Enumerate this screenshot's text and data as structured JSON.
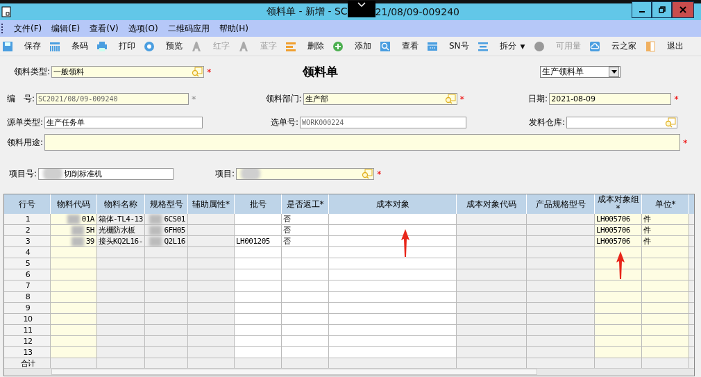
{
  "window": {
    "title_left": "领料单 - 新增 - SC",
    "title_right": "21/08/09-009240"
  },
  "menu": [
    "文件(F)",
    "编辑(E)",
    "查看(V)",
    "选项(O)",
    "二维码应用",
    "帮助(H)"
  ],
  "toolbar": [
    {
      "label": "保存",
      "disabled": false
    },
    {
      "label": "条码",
      "disabled": false
    },
    {
      "label": "打印",
      "disabled": false
    },
    {
      "label": "预览",
      "disabled": false
    },
    {
      "label": "红字",
      "disabled": true
    },
    {
      "label": "蓝字",
      "disabled": true
    },
    {
      "label": "删除",
      "disabled": false
    },
    {
      "label": "添加",
      "disabled": false
    },
    {
      "label": "查看",
      "disabled": false
    },
    {
      "label": "SN号",
      "disabled": false
    },
    {
      "label": "拆分",
      "disabled": false,
      "dropdown": "▼"
    },
    {
      "label": "可用量",
      "disabled": true
    },
    {
      "label": "云之家",
      "disabled": false
    },
    {
      "label": "退出",
      "disabled": false
    }
  ],
  "form": {
    "heading": "领料单",
    "bill_type": "生产领料单",
    "rows": [
      [
        {
          "label": "领料类型:",
          "value": "一般领料",
          "kind": "yellow",
          "lookup": true,
          "required": "*"
        }
      ],
      [
        {
          "label": "编　号:",
          "value": "SC2021/08/09-009240",
          "kind": "locked",
          "required": "*"
        },
        {
          "label": "领料部门:",
          "value": "生产部",
          "kind": "yellow",
          "lookup": true,
          "required": "*"
        },
        {
          "label": "日期:",
          "value": "2021-08-09",
          "kind": "yellow",
          "required": "*"
        }
      ],
      [
        {
          "label": "源单类型:",
          "value": "生产任务单",
          "kind": "plain"
        },
        {
          "label": "选单号:",
          "value": "WORK000224",
          "kind": "locked_plain"
        },
        {
          "label": "发料仓库:",
          "kind": "plain",
          "lookup": true
        }
      ],
      [
        {
          "label": "领料用途:",
          "kind": "yellow",
          "required": "*"
        }
      ],
      [
        {
          "label": "项目号:",
          "value": "切削标准机",
          "kind": "plain"
        },
        {
          "label": "项目:",
          "kind": "yellow",
          "lookup": true,
          "required": "*"
        }
      ]
    ]
  },
  "table": {
    "columns": [
      {
        "label": "行号",
        "kind": "num"
      },
      {
        "label": "物料代码",
        "kind": "yellow"
      },
      {
        "label": "物料名称",
        "kind": "plain"
      },
      {
        "label": "规格型号",
        "kind": "plain"
      },
      {
        "label": "辅助属性*",
        "kind": "plain"
      },
      {
        "label": "批号",
        "kind": "white"
      },
      {
        "label": "是否返工*",
        "kind": "white"
      },
      {
        "label": "成本对象",
        "kind": "white"
      },
      {
        "label": "成本对象代码",
        "kind": "plain"
      },
      {
        "label": "产品规格型号",
        "kind": "plain"
      },
      {
        "label": "成本对象组*",
        "kind": "yellow"
      },
      {
        "label": "单位*",
        "kind": "yellow"
      },
      {
        "kind": "plain"
      }
    ],
    "rows": [
      [
        "1",
        "01A",
        "箱体-TL4-13",
        "6CS01",
        "",
        "",
        "否",
        "",
        "",
        "",
        "LH005706",
        "件",
        ""
      ],
      [
        "2",
        "5H",
        "光栅防水板",
        "6FH05",
        "",
        "",
        "否",
        "",
        "",
        "",
        "LH005706",
        "件",
        ""
      ],
      [
        "3",
        "39",
        "接头KQ2L16-",
        "Q2L16",
        "",
        "LH001205",
        "否",
        "",
        "",
        "",
        "LH005706",
        "件",
        ""
      ],
      [
        "4",
        "",
        "",
        "",
        "",
        "",
        "",
        "",
        "",
        "",
        "",
        "",
        ""
      ],
      [
        "5",
        "",
        "",
        "",
        "",
        "",
        "",
        "",
        "",
        "",
        "",
        "",
        ""
      ],
      [
        "6",
        "",
        "",
        "",
        "",
        "",
        "",
        "",
        "",
        "",
        "",
        "",
        ""
      ],
      [
        "7",
        "",
        "",
        "",
        "",
        "",
        "",
        "",
        "",
        "",
        "",
        "",
        ""
      ],
      [
        "8",
        "",
        "",
        "",
        "",
        "",
        "",
        "",
        "",
        "",
        "",
        "",
        ""
      ],
      [
        "9",
        "",
        "",
        "",
        "",
        "",
        "",
        "",
        "",
        "",
        "",
        "",
        ""
      ],
      [
        "10",
        "",
        "",
        "",
        "",
        "",
        "",
        "",
        "",
        "",
        "",
        "",
        ""
      ],
      [
        "11",
        "",
        "",
        "",
        "",
        "",
        "",
        "",
        "",
        "",
        "",
        "",
        ""
      ],
      [
        "12",
        "",
        "",
        "",
        "",
        "",
        "",
        "",
        "",
        "",
        "",
        "",
        ""
      ],
      [
        "13",
        "",
        "",
        "",
        "",
        "",
        "",
        "",
        "",
        "",
        "",
        "",
        ""
      ]
    ],
    "total_label": "合计",
    "annotations": [
      {
        "kind": "arrow"
      },
      {
        "kind": "arrow"
      }
    ]
  }
}
